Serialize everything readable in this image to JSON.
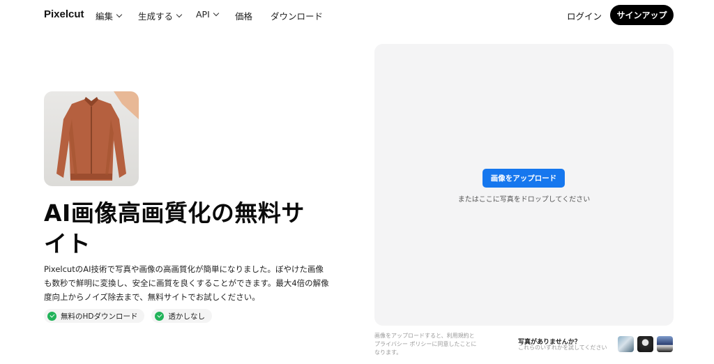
{
  "nav": {
    "logo": "Pixelcut",
    "items": [
      {
        "label": "編集",
        "has_dropdown": true
      },
      {
        "label": "生成する",
        "has_dropdown": true
      },
      {
        "label": "API",
        "has_dropdown": true
      },
      {
        "label": "価格",
        "has_dropdown": false
      },
      {
        "label": "ダウンロード",
        "has_dropdown": false
      }
    ],
    "login": "ログイン",
    "signup": "サインアップ"
  },
  "hero": {
    "headline": "AI画像高画質化の無料サイト",
    "description": "PixelcutのAI技術で写真や画像の高画質化が簡単になりました。ぼやけた画像も数秒で鮮明に変換し、安全に画質を良くすることができます。最大4倍の解像度向上からノイズ除去まで、無料サイトでお試しください。",
    "badges": [
      "無料のHDダウンロード",
      "透かしなし"
    ]
  },
  "upload": {
    "button": "画像をアップロード",
    "drop_text": "またはここに写真をドロップしてください",
    "terms": "画像をアップロードすると、利用規約とプライバシー ポリシーに同意したことになります。",
    "no_photo_title": "写真がありませんか？",
    "no_photo_sub": "これらのいずれかを試してください"
  },
  "colors": {
    "accent": "#1677ee",
    "signup_bg": "#000000",
    "check": "#22b35a"
  }
}
